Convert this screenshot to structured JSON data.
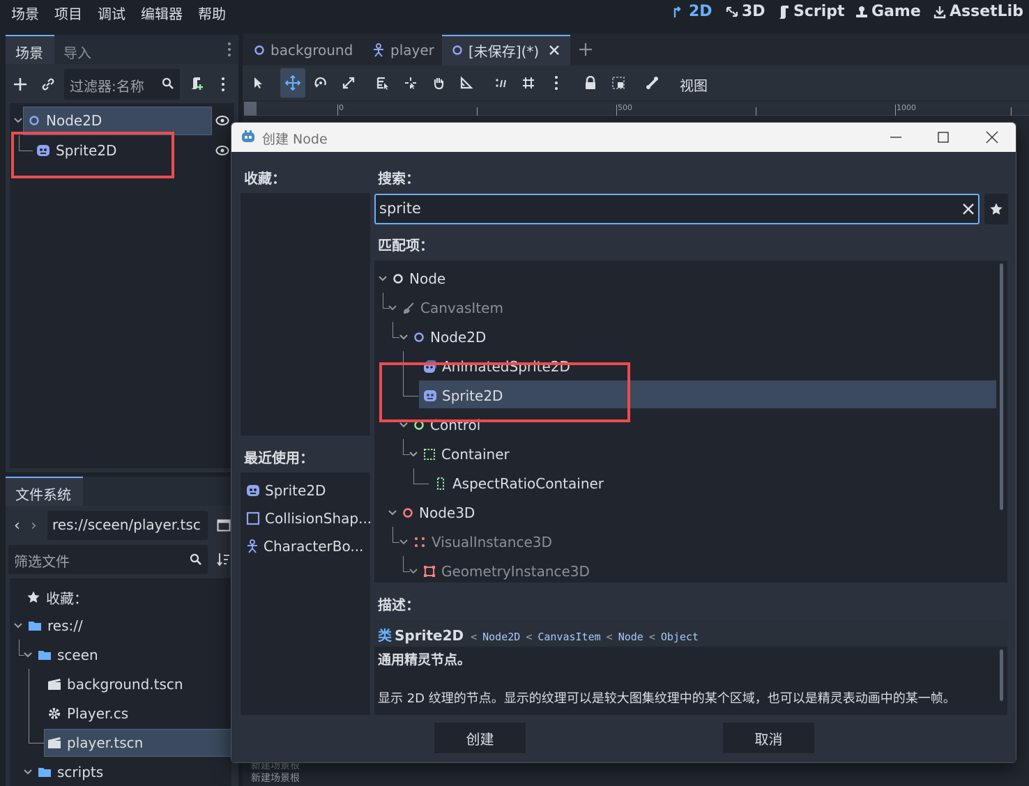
{
  "menu": [
    "场景",
    "项目",
    "调试",
    "编辑器",
    "帮助"
  ],
  "workspaces": [
    {
      "label": "2D",
      "icon": "2d-icon",
      "active": true
    },
    {
      "label": "3D",
      "icon": "3d-icon"
    },
    {
      "label": "Script",
      "icon": "script-icon"
    },
    {
      "label": "Game",
      "icon": "game-icon"
    },
    {
      "label": "AssetLib",
      "icon": "assetlib-icon"
    }
  ],
  "scene_dock": {
    "tabs": [
      "场景",
      "导入"
    ],
    "filter_placeholder": "过滤器:名称",
    "tree": [
      {
        "label": "Node2D",
        "icon": "node2d-icon"
      },
      {
        "label": "Sprite2D",
        "icon": "sprite2d-icon"
      }
    ]
  },
  "filesystem": {
    "tab": "文件系统",
    "path": "res://sceen/player.tsc",
    "filter_placeholder": "筛选文件",
    "items": [
      {
        "label": "收藏：",
        "icon": "star-icon"
      },
      {
        "label": "res://",
        "icon": "folder-icon"
      },
      {
        "label": "sceen",
        "icon": "folder-icon"
      },
      {
        "label": "background.tscn",
        "icon": "scene-file-icon"
      },
      {
        "label": "Player.cs",
        "icon": "gear-file-icon"
      },
      {
        "label": "player.tscn",
        "icon": "scene-file-icon"
      },
      {
        "label": "scripts",
        "icon": "folder-icon"
      }
    ]
  },
  "editor_tabs": [
    {
      "label": "background",
      "icon": "node2d-icon"
    },
    {
      "label": "player",
      "icon": "characterbody-icon"
    },
    {
      "label": "[未保存](*)",
      "icon": "node2d-icon",
      "active": true
    }
  ],
  "toolbar": {
    "view_label": "视图"
  },
  "ruler": {
    "labels": [
      "0",
      "500",
      "1000"
    ]
  },
  "bottom_text": [
    "新建场景根",
    "新建场景根"
  ],
  "dialog": {
    "title": "创建 Node",
    "favorites_label": "收藏：",
    "recent_label": "最近使用：",
    "recent_items": [
      {
        "label": "Sprite2D",
        "icon": "sprite2d-icon"
      },
      {
        "label": "CollisionShap...",
        "icon": "collisionshape-icon"
      },
      {
        "label": "CharacterBo...",
        "icon": "characterbody-icon"
      }
    ],
    "search_label": "搜索：",
    "search_value": "sprite",
    "matches_label": "匹配项：",
    "matches": [
      {
        "label": "Node",
        "icon": "node-icon"
      },
      {
        "label": "CanvasItem",
        "icon": "canvasitem-icon"
      },
      {
        "label": "Node2D",
        "icon": "node2d-icon"
      },
      {
        "label": "AnimatedSprite2D",
        "icon": "animatedsprite-icon"
      },
      {
        "label": "Sprite2D",
        "icon": "sprite2d-icon",
        "selected": true
      },
      {
        "label": "Control",
        "icon": "control-icon"
      },
      {
        "label": "Container",
        "icon": "container-icon"
      },
      {
        "label": "AspectRatioContainer",
        "icon": "aspectratio-icon"
      },
      {
        "label": "Node3D",
        "icon": "node3d-icon"
      },
      {
        "label": "VisualInstance3D",
        "icon": "visualinstance-icon"
      },
      {
        "label": "GeometryInstance3D",
        "icon": "geometryinstance-icon"
      }
    ],
    "description_label": "描述：",
    "desc_class_prefix": "类",
    "desc_class": "Sprite2D",
    "desc_inheritance": [
      "Node2D",
      "CanvasItem",
      "Node",
      "Object"
    ],
    "desc_brief": "通用精灵节点。",
    "desc_text": "显示 2D 纹理的节点。显示的纹理可以是较大图集纹理中的某个区域，也可以是精灵表动画中的某一帧。",
    "create_button": "创建",
    "cancel_button": "取消"
  },
  "colors": {
    "accent": "#6ab0ff",
    "node2d": "#8da5f3",
    "control": "#8eef97",
    "node3d": "#fc7f7f",
    "highlight": "#ee4b50"
  }
}
